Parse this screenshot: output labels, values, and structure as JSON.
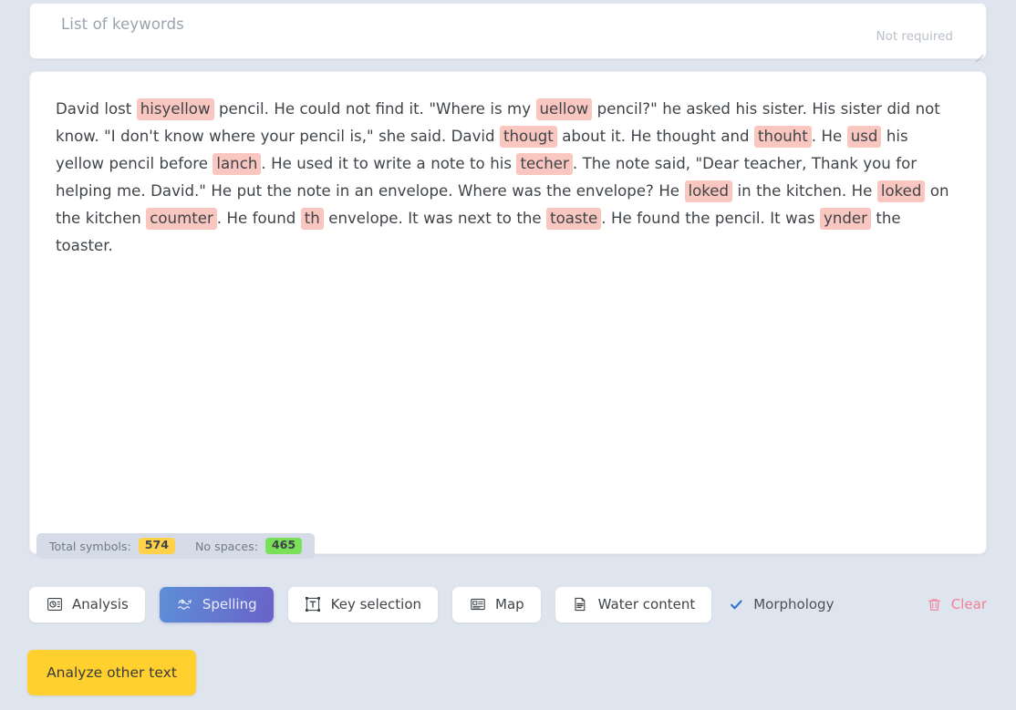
{
  "keywords": {
    "placeholder": "List of keywords",
    "value": "",
    "hint": "Not required"
  },
  "text_panel": {
    "segments": [
      {
        "t": "David lost ",
        "h": false
      },
      {
        "t": "hisyellow",
        "h": true
      },
      {
        "t": " pencil. He could not find it. \"Where is my ",
        "h": false
      },
      {
        "t": "uellow",
        "h": true
      },
      {
        "t": " pencil?\" he asked his sister. His sister did not know. \"I don't know where your pencil is,\" she said. David ",
        "h": false
      },
      {
        "t": "thougt",
        "h": true
      },
      {
        "t": " about it. He thought and ",
        "h": false
      },
      {
        "t": "thouht",
        "h": true
      },
      {
        "t": ". He ",
        "h": false
      },
      {
        "t": "usd",
        "h": true
      },
      {
        "t": " his yellow pencil before ",
        "h": false
      },
      {
        "t": "lanch",
        "h": true
      },
      {
        "t": ". He used it to write a note to his ",
        "h": false
      },
      {
        "t": "techer",
        "h": true
      },
      {
        "t": ". The note said, \"Dear teacher, Thank you for helping me. David.\" He put the note in an envelope. Where was the envelope? He ",
        "h": false
      },
      {
        "t": "loked",
        "h": true
      },
      {
        "t": " in the kitchen. He ",
        "h": false
      },
      {
        "t": "loked",
        "h": true
      },
      {
        "t": " on the kitchen ",
        "h": false
      },
      {
        "t": "coumter",
        "h": true
      },
      {
        "t": ". He found ",
        "h": false
      },
      {
        "t": "th",
        "h": true
      },
      {
        "t": " envelope. It was next to the ",
        "h": false
      },
      {
        "t": "toaste",
        "h": true
      },
      {
        "t": ". He found the pencil. It was ",
        "h": false
      },
      {
        "t": "ynder",
        "h": true
      },
      {
        "t": " the toaster.",
        "h": false
      }
    ]
  },
  "stats": {
    "total_label": "Total symbols:",
    "total_value": "574",
    "nospaces_label": "No spaces:",
    "nospaces_value": "465"
  },
  "toolbar": {
    "buttons": [
      {
        "label": "Analysis",
        "icon": "analysis-icon",
        "active": false
      },
      {
        "label": "Spelling",
        "icon": "spelling-icon",
        "active": true
      },
      {
        "label": "Key selection",
        "icon": "key-selection-icon",
        "active": false
      },
      {
        "label": "Map",
        "icon": "map-icon",
        "active": false
      },
      {
        "label": "Water content",
        "icon": "water-content-icon",
        "active": false
      }
    ],
    "morphology": {
      "label": "Morphology",
      "checked": true
    },
    "clear": {
      "label": "Clear",
      "icon": "trash-icon"
    }
  },
  "actions": {
    "analyze_other": "Analyze other text"
  },
  "colors": {
    "page_bg": "#dfe5ee",
    "panel_bg": "#ffffff",
    "highlight": "#f9c6c0",
    "active_gradient_from": "#5d8fd6",
    "active_gradient_to": "#6a62c9",
    "amber_pill": "#ffd24a",
    "green_pill": "#7ae05a",
    "clear_red": "#f08098",
    "primary_yellow": "#ffd02e"
  }
}
